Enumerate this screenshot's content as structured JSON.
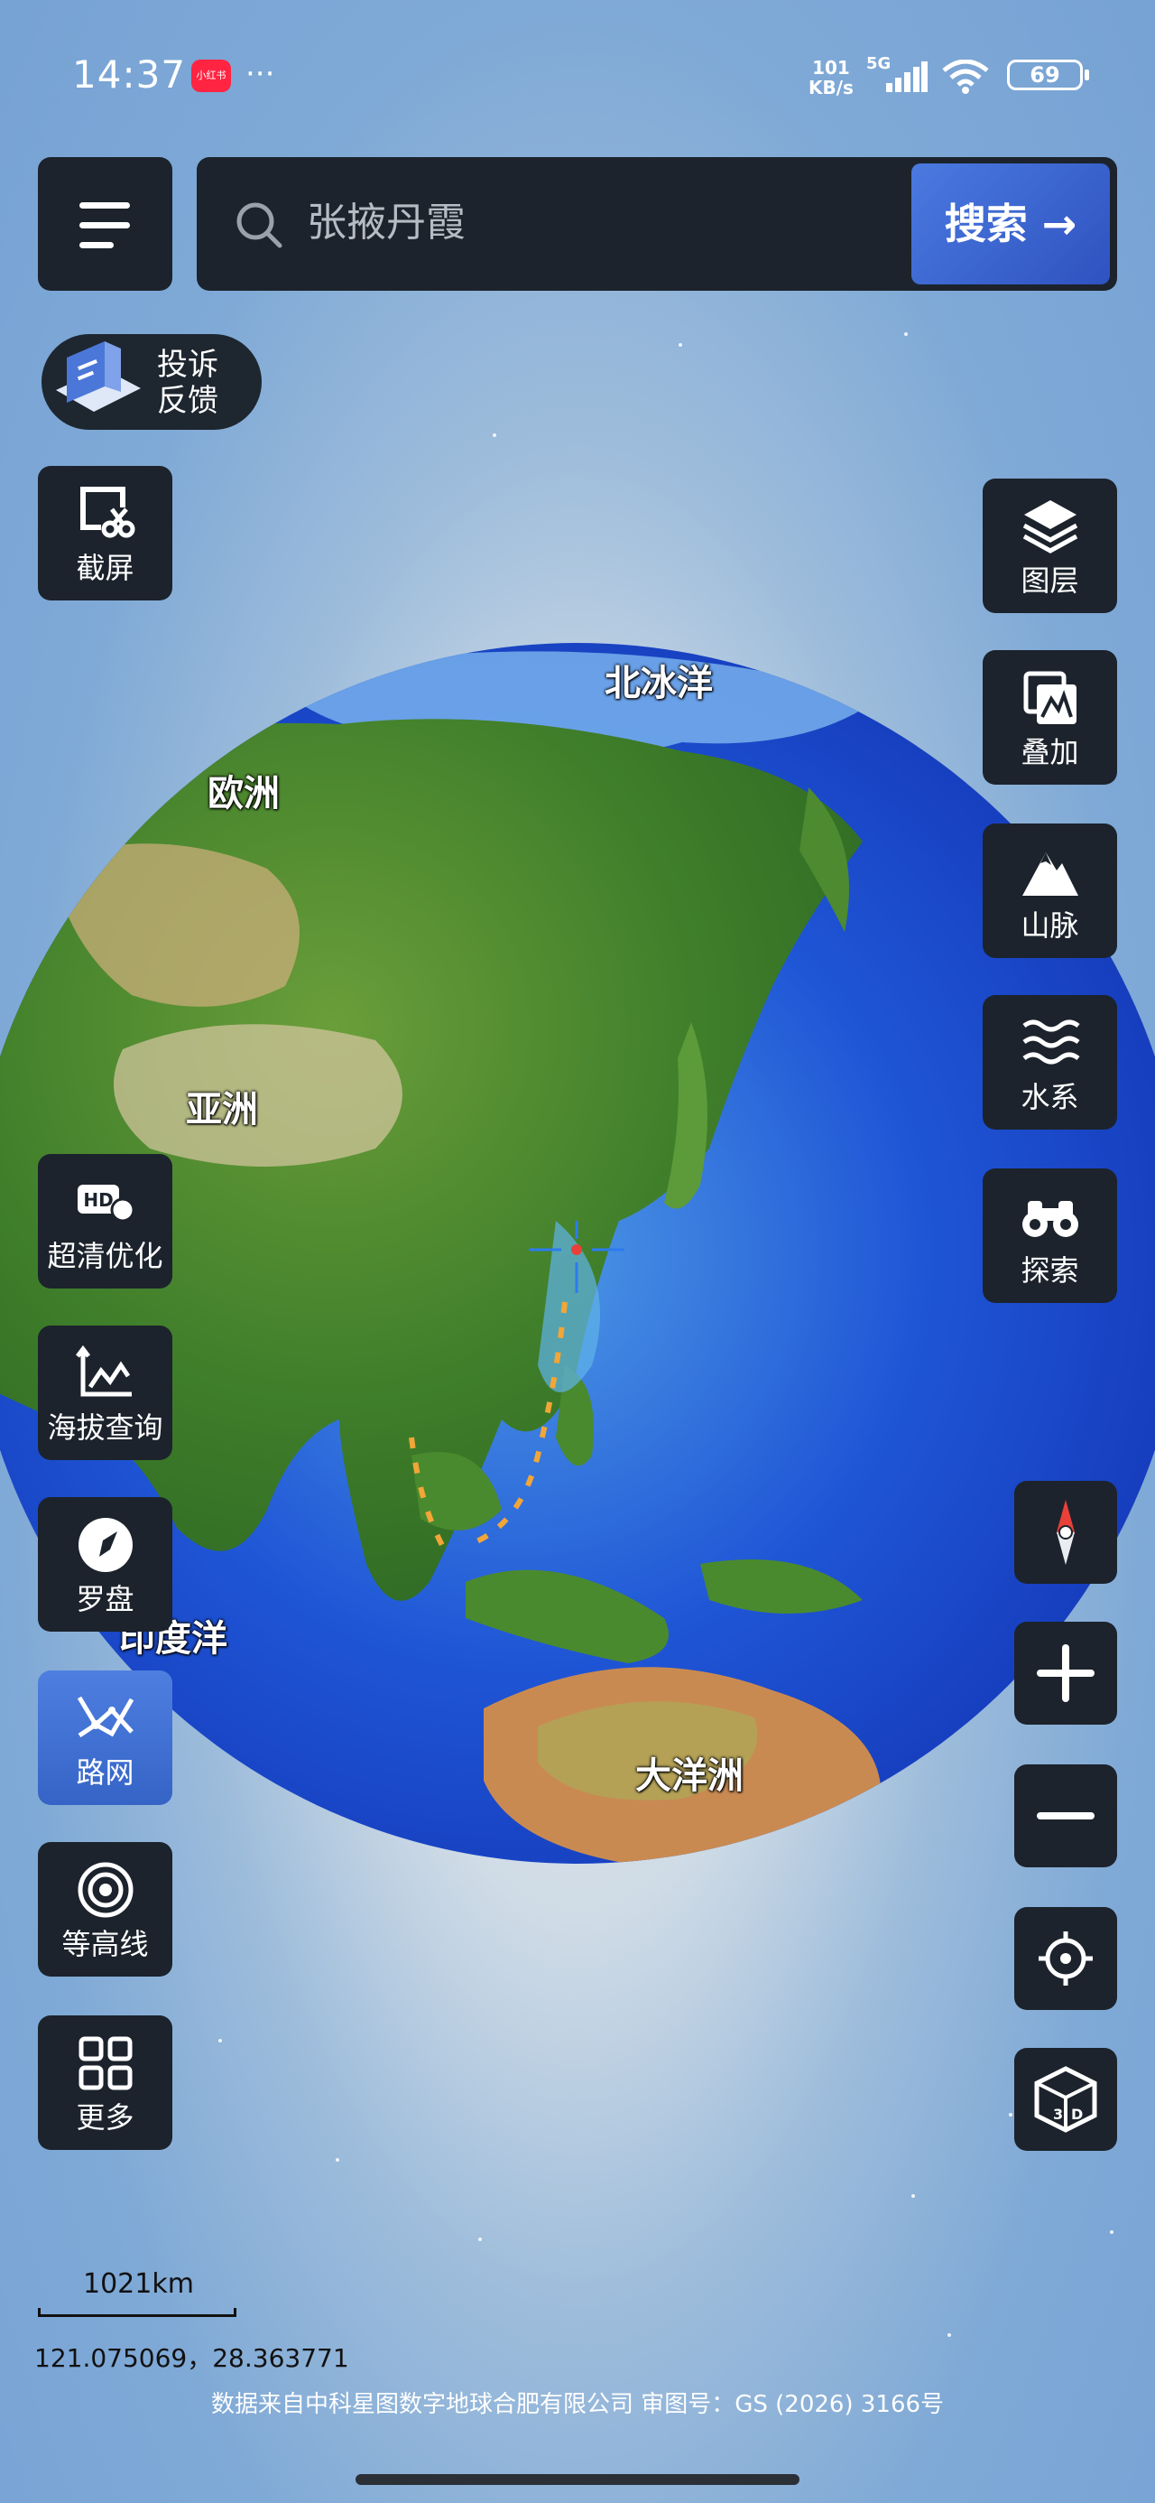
{
  "status_bar": {
    "time": "14:37",
    "app_badge": "小红书",
    "more": "···",
    "speed_value": "101",
    "speed_unit": "KB/s",
    "network": "5G",
    "battery": "69"
  },
  "search": {
    "placeholder": "张掖丹霞",
    "button_label": "搜索 →"
  },
  "complaint": {
    "line1": "投诉",
    "line2": "反馈",
    "icon_text": "投诉反馈"
  },
  "left_tools": [
    {
      "label": "截屏",
      "icon": "screenshot-icon"
    },
    {
      "label": "超清优化",
      "icon": "hd-icon"
    },
    {
      "label": "海拔查询",
      "icon": "altitude-icon"
    },
    {
      "label": "罗盘",
      "icon": "compass-icon"
    },
    {
      "label": "路网",
      "icon": "road-network-icon",
      "active": true
    },
    {
      "label": "等高线",
      "icon": "contour-icon"
    },
    {
      "label": "更多",
      "icon": "grid-icon"
    }
  ],
  "right_tools": [
    {
      "label": "图层",
      "icon": "layers-icon"
    },
    {
      "label": "叠加",
      "icon": "overlay-icon"
    },
    {
      "label": "山脉",
      "icon": "mountain-icon"
    },
    {
      "label": "水系",
      "icon": "water-icon"
    },
    {
      "label": "探索",
      "icon": "binoculars-icon"
    }
  ],
  "map_controls": [
    "north-arrow-icon",
    "zoom-in-icon",
    "zoom-out-icon",
    "locate-icon",
    "3d-icon"
  ],
  "map_labels": {
    "arctic": "北冰洋",
    "europe": "欧洲",
    "asia": "亚洲",
    "indian_ocean": "印度洋",
    "oceania": "大洋洲"
  },
  "scale": "1021km",
  "coordinates": "121.075069，28.363771",
  "source_text": "数据来自中科星图数字地球合肥有限公司 审图号：GS (2026) 3166号",
  "colors": {
    "panel": "#1c232c",
    "accent": "#3f6fd8",
    "ocean": "#1f4fd6"
  }
}
